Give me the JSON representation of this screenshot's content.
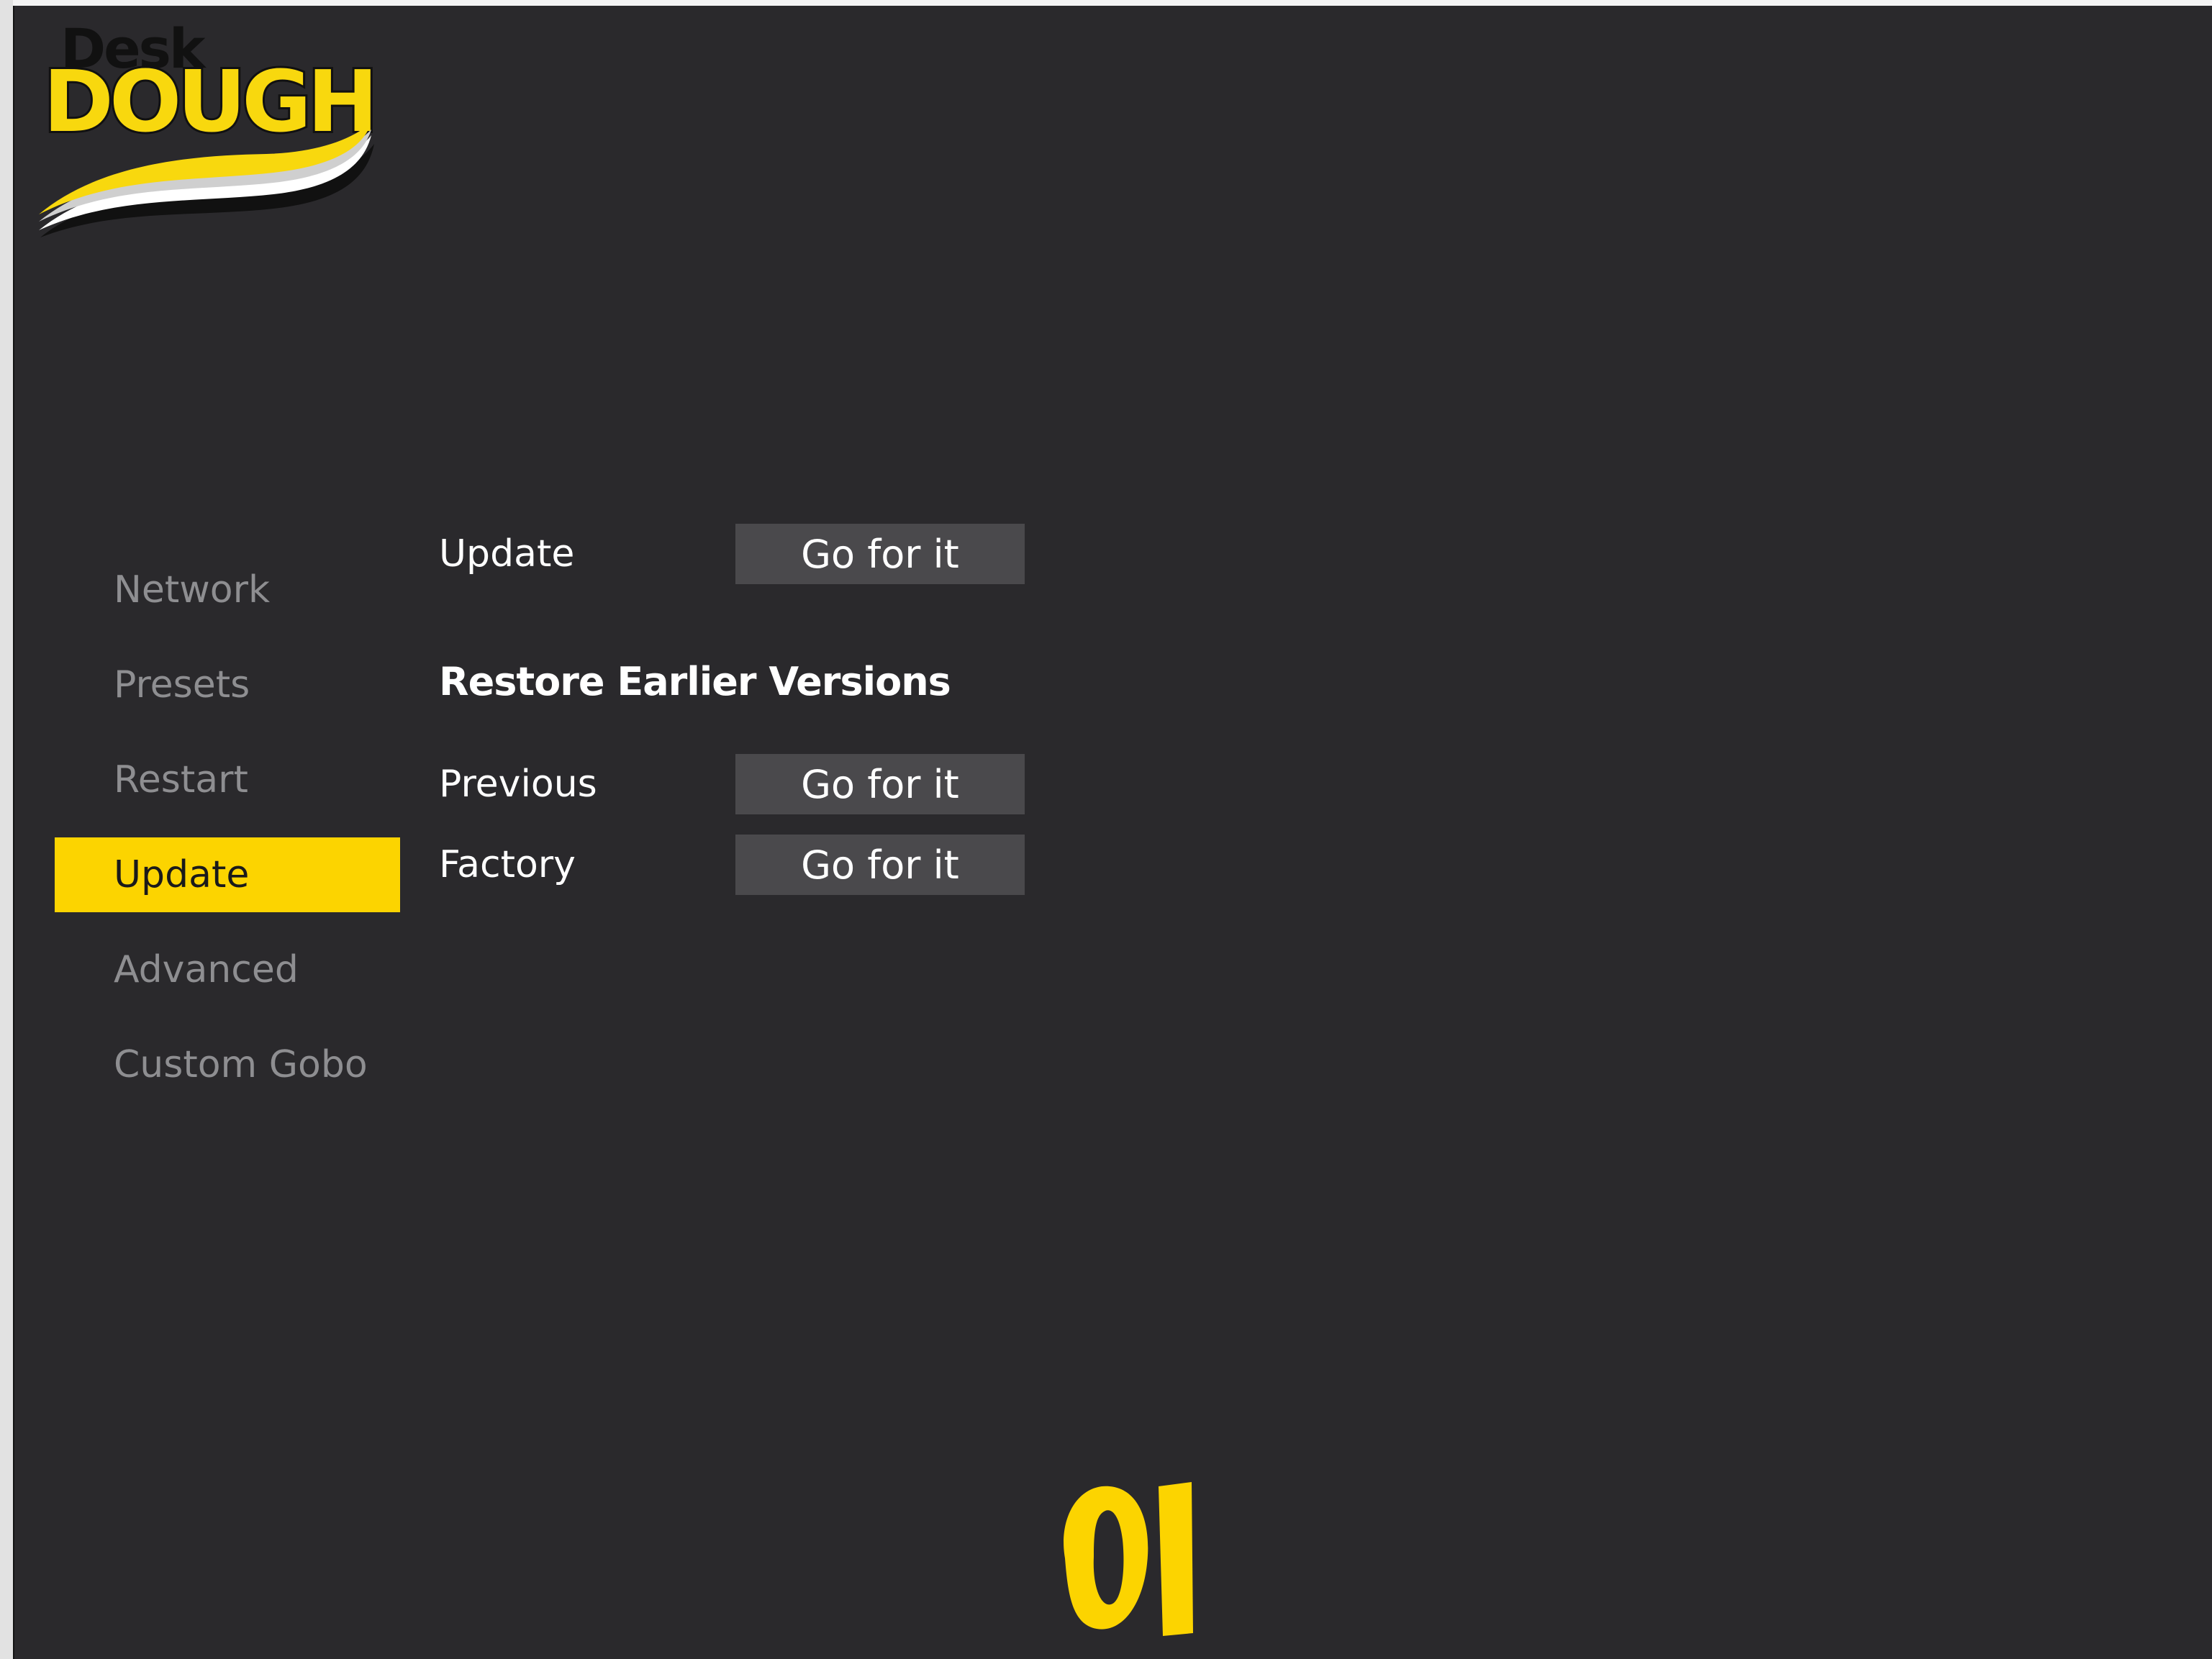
{
  "logo": {
    "top_text": "Desk",
    "main_text": "DOUGH"
  },
  "sidebar": {
    "items": [
      {
        "label": "Network",
        "active": false
      },
      {
        "label": "Presets",
        "active": false
      },
      {
        "label": "Restart",
        "active": false
      },
      {
        "label": "Update",
        "active": true
      },
      {
        "label": "Advanced",
        "active": false
      },
      {
        "label": "Custom Gobo",
        "active": false
      }
    ]
  },
  "main": {
    "update_row": {
      "label": "Update",
      "button": "Go for it"
    },
    "restore_title": "Restore Earlier Versions",
    "previous_row": {
      "label": "Previous",
      "button": "Go for it"
    },
    "factory_row": {
      "label": "Factory",
      "button": "Go for it"
    }
  },
  "colors": {
    "background": "#2a292c",
    "accent": "#fcd400",
    "button": "#4a494c",
    "inactive_text": "#8e8e91"
  },
  "icons": {
    "bottom_mark": "brand-mark-icon"
  }
}
